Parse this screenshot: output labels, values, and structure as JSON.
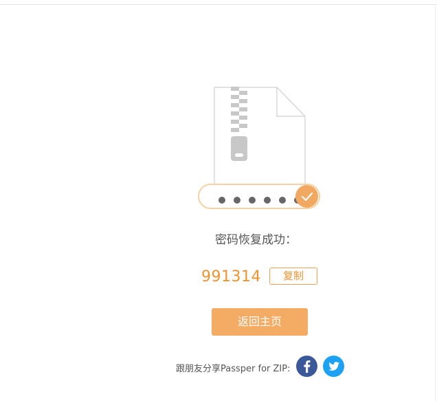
{
  "result": {
    "masked_password_dots": 6,
    "success_label": "密码恢复成功：",
    "password": "991314",
    "copy_label": "复制"
  },
  "actions": {
    "home_label": "返回主页"
  },
  "share": {
    "text": "跟朋友分享Passper for ZIP:",
    "icons": [
      "facebook-icon",
      "twitter-icon"
    ]
  },
  "colors": {
    "accent": "#f0932f",
    "button_fill": "#f4ac64",
    "pill_border": "#f6d1a4",
    "facebook": "#3b5998",
    "twitter": "#1da1f2"
  }
}
